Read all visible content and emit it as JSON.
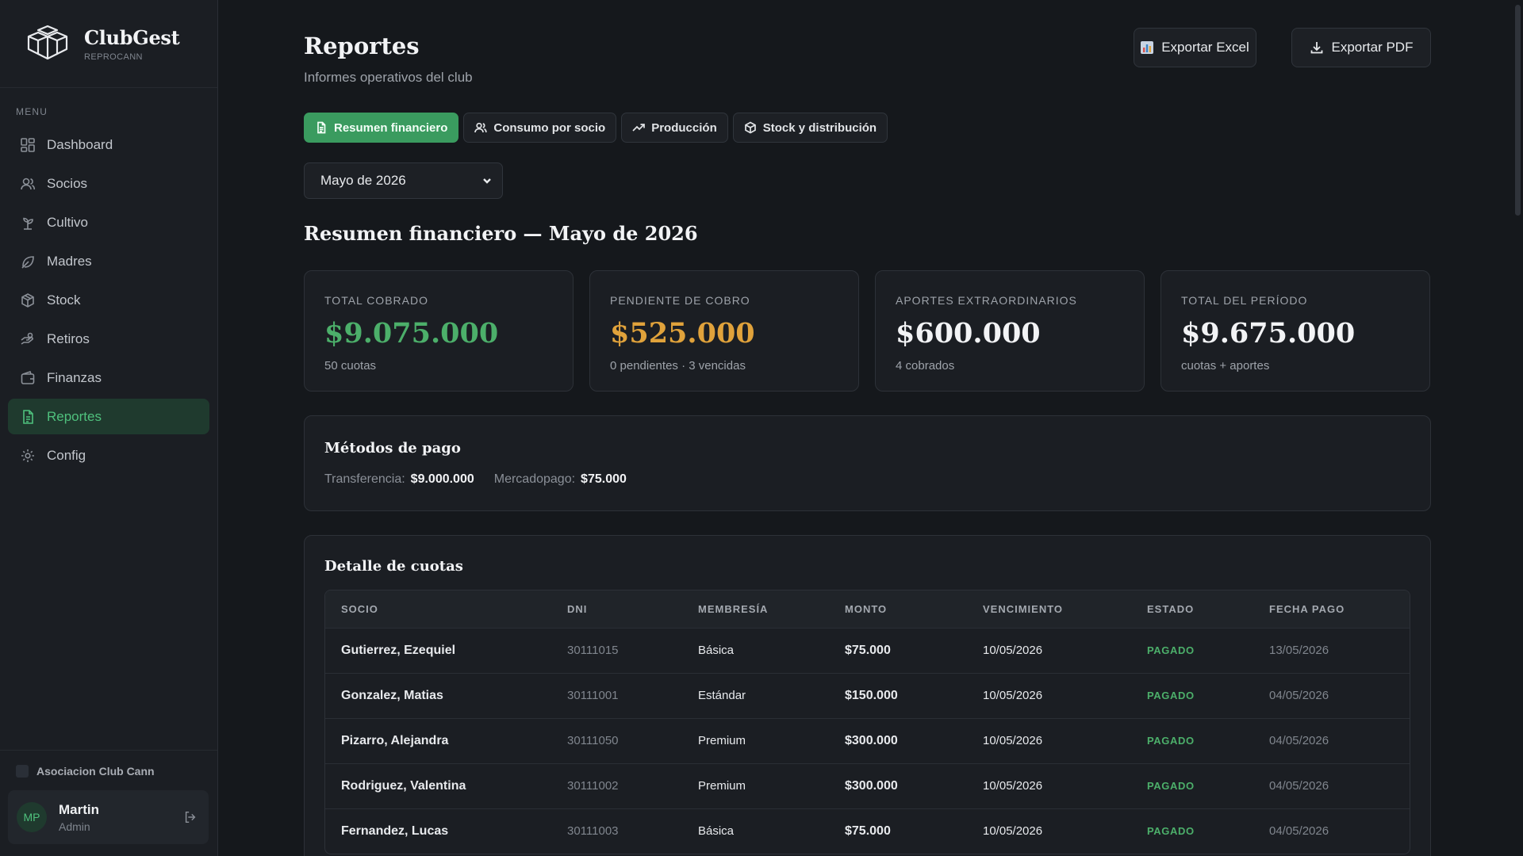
{
  "brand": {
    "name": "ClubGest",
    "sub": "REPROCANN"
  },
  "sidebar": {
    "menu_label": "MENU",
    "items": [
      {
        "label": "Dashboard",
        "icon": "dashboard-icon"
      },
      {
        "label": "Socios",
        "icon": "users-icon"
      },
      {
        "label": "Cultivo",
        "icon": "sprout-icon"
      },
      {
        "label": "Madres",
        "icon": "leaf-icon"
      },
      {
        "label": "Stock",
        "icon": "package-icon"
      },
      {
        "label": "Retiros",
        "icon": "hand-icon"
      },
      {
        "label": "Finanzas",
        "icon": "wallet-icon"
      },
      {
        "label": "Reportes",
        "icon": "report-icon",
        "active": true
      },
      {
        "label": "Config",
        "icon": "gear-icon"
      }
    ],
    "org": "Asociacion Club Cann",
    "user": {
      "initials": "MP",
      "name": "Martin",
      "role": "Admin"
    }
  },
  "header": {
    "title": "Reportes",
    "subtitle": "Informes operativos del club",
    "export_excel": "Exportar Excel",
    "export_pdf": "Exportar PDF"
  },
  "tabs": [
    {
      "label": "Resumen financiero",
      "active": true
    },
    {
      "label": "Consumo por socio"
    },
    {
      "label": "Producción"
    },
    {
      "label": "Stock y distribución"
    }
  ],
  "period": {
    "selected": "Mayo de 2026"
  },
  "section_title": "Resumen financiero — Mayo de 2026",
  "kpis": [
    {
      "label": "TOTAL COBRADO",
      "value": "$9.075.000",
      "sub": "50 cuotas",
      "color": "#4caf6a"
    },
    {
      "label": "PENDIENTE DE COBRO",
      "value": "$525.000",
      "sub": "0 pendientes · 3 vencidas",
      "color": "#e0a23b"
    },
    {
      "label": "APORTES EXTRAORDINARIOS",
      "value": "$600.000",
      "sub": "4 cobrados",
      "color": "#f2f3f5"
    },
    {
      "label": "TOTAL DEL PERÍODO",
      "value": "$9.675.000",
      "sub": "cuotas + aportes",
      "color": "#f2f3f5"
    }
  ],
  "payment_methods": {
    "title": "Métodos de pago",
    "items": [
      {
        "label": "Transferencia:",
        "value": "$9.000.000"
      },
      {
        "label": "Mercadopago:",
        "value": "$75.000"
      }
    ]
  },
  "detail": {
    "title": "Detalle de cuotas",
    "columns": [
      "SOCIO",
      "DNI",
      "MEMBRESÍA",
      "MONTO",
      "VENCIMIENTO",
      "ESTADO",
      "FECHA PAGO"
    ],
    "rows": [
      [
        "Gutierrez, Ezequiel",
        "30111015",
        "Básica",
        "$75.000",
        "10/05/2026",
        "PAGADO",
        "13/05/2026"
      ],
      [
        "Gonzalez, Matias",
        "30111001",
        "Estándar",
        "$150.000",
        "10/05/2026",
        "PAGADO",
        "04/05/2026"
      ],
      [
        "Pizarro, Alejandra",
        "30111050",
        "Premium",
        "$300.000",
        "10/05/2026",
        "PAGADO",
        "04/05/2026"
      ],
      [
        "Rodriguez, Valentina",
        "30111002",
        "Premium",
        "$300.000",
        "10/05/2026",
        "PAGADO",
        "04/05/2026"
      ],
      [
        "Fernandez, Lucas",
        "30111003",
        "Básica",
        "$75.000",
        "10/05/2026",
        "PAGADO",
        "04/05/2026"
      ]
    ]
  }
}
